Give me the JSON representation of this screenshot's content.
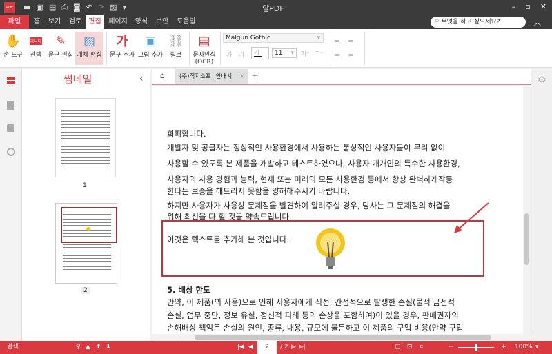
{
  "app": {
    "title": "알PDF",
    "logo": "PDF"
  },
  "window_controls": [
    "minimize",
    "maximize",
    "close"
  ],
  "quick_toolbar": [
    "open-folder-icon",
    "save-icon",
    "scan-icon",
    "print-icon",
    "zoom-page-icon",
    "undo-icon",
    "redo-icon",
    "recent-icon",
    "dropdown-icon"
  ],
  "menu": {
    "file": "파일",
    "items": [
      "홈",
      "보기",
      "검토",
      "편집",
      "페이지",
      "양식",
      "보안",
      "도움말"
    ],
    "active": "편집"
  },
  "search": {
    "placeholder": "무엇을 하고 싶으세요?"
  },
  "ribbon": {
    "buttons": [
      {
        "label": "손 도구",
        "icon": "hand-icon"
      },
      {
        "label": "선택",
        "icon": "select-text-icon",
        "badge": "가나다"
      },
      {
        "label": "문구 편집",
        "icon": "edit-text-icon"
      },
      {
        "label": "개체 편집",
        "icon": "edit-object-icon",
        "active": true
      },
      {
        "label": "문구 추가",
        "icon": "add-text-icon",
        "glyph": "가"
      },
      {
        "label": "그림 추가",
        "icon": "add-image-icon"
      },
      {
        "label": "링크",
        "icon": "link-icon"
      },
      {
        "label": "문자인식",
        "label2": "(OCR)",
        "icon": "ocr-icon"
      }
    ],
    "font": "Malgun Gothic",
    "font_size": "11",
    "color_glyph": "가",
    "bold_glyph": "가",
    "italic_glyph": "가"
  },
  "sidebar": {
    "title": "썸네일",
    "pages": [
      "1",
      "2"
    ],
    "selected_page": "2"
  },
  "tabs": [
    {
      "label": "(주)직지소프_ 안내서"
    }
  ],
  "document": {
    "lines": [
      "회피합니다.",
      "개발자 및 공급자는 정상적인 사용환경에서 사용하는 통상적인 사용자들이 무리 없이",
      "사용할 수 있도록 본 제품을 개발하고 테스트하였으나, 사용자 개개인의 특수한 사용환경,",
      "사용자의 사용 경험과 능력, 현재 또는 미래의 모든 사용환경 등에서 항상 완벽하게작동",
      "한다는 보증을 해드리지 못함을 양해해주시기 바랍니다.",
      "하지만 사용자가 사용상 문제점을 발견하여 알려주실 경우, 당사는 그 문제점의 해결을",
      "위해 최선을 다 할 것을 약속드립니다."
    ],
    "added_text": "이것은 텍스트를 추가해 본 것입니다.",
    "section_title": "5. 배상 한도",
    "section_lines": [
      "만약, 이 제품(의 사용)으로 인해 사용자에게 직접, 간접적으로 발생한 손실(물적 금전적",
      "손실, 업무 중단, 정보 유실, 정신적 피해 등의 손상을 포함하여)이 있을 경우, 판매권자의",
      "손해배상 책임은 손실의 원인, 종류, 내용, 규모에 불문하고 이 제품의 구입 비용(만약 구입"
    ]
  },
  "status": {
    "search_label": "검색",
    "current_page": "2",
    "total_pages": "/ 2",
    "zoom": "100%",
    "zoom_level": 0.5
  },
  "colors": {
    "accent": "#d9393f",
    "dark": "#3b3b3b"
  }
}
